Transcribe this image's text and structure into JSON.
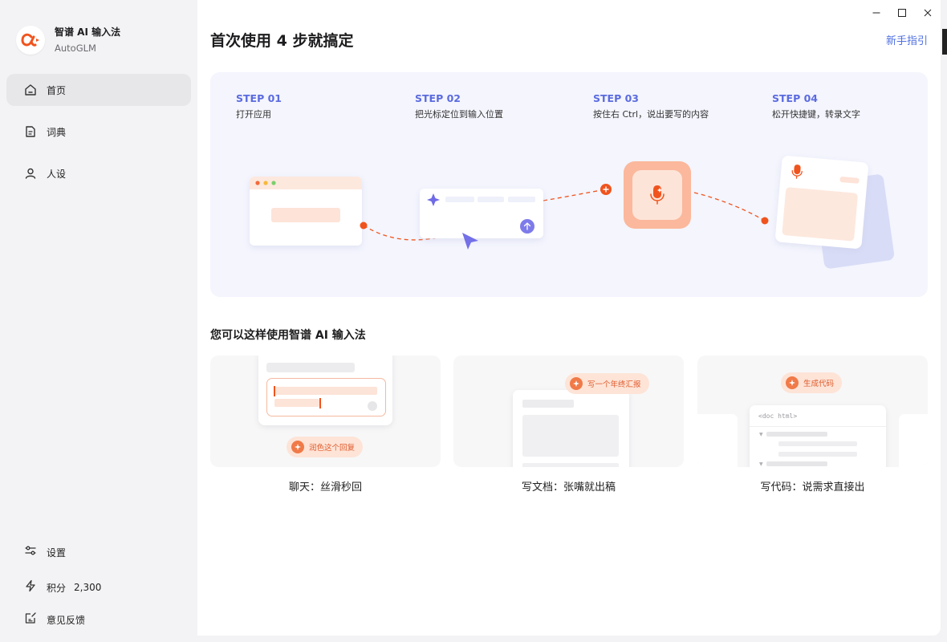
{
  "brand": {
    "name": "智谱 AI 输入法",
    "sub": "AutoGLM",
    "logo_icon": "alpha-logo-icon",
    "accent": "#f0541e"
  },
  "sidebar": {
    "items": [
      {
        "label": "首页",
        "icon": "home-icon",
        "active": true
      },
      {
        "label": "词典",
        "icon": "dictionary-icon",
        "active": false
      },
      {
        "label": "人设",
        "icon": "persona-icon",
        "active": false
      }
    ],
    "bottom": {
      "settings_label": "设置",
      "points_label": "积分",
      "points_value": "2,300",
      "feedback_label": "意见反馈"
    }
  },
  "header": {
    "title": "首次使用 4 步就搞定",
    "guide_link": "新手指引"
  },
  "steps": [
    {
      "no": "STEP 01",
      "desc": "打开应用"
    },
    {
      "no": "STEP 02",
      "desc": "把光标定位到输入位置"
    },
    {
      "no": "STEP 03",
      "desc": "按住右 Ctrl，说出要写的内容"
    },
    {
      "no": "STEP 04",
      "desc": "松开快捷键，转录文字"
    }
  ],
  "usage": {
    "title": "您可以这样使用智谱 AI 输入法",
    "cards": [
      {
        "caption": "聊天：丝滑秒回",
        "pill": "润色这个回复"
      },
      {
        "caption": "写文档：张嘴就出稿",
        "pill": "写一个年终汇报"
      },
      {
        "caption": "写代码：说需求直接出",
        "pill": "生成代码",
        "code_hint": "<doc html>"
      }
    ]
  },
  "colors": {
    "accent_orange": "#f0541e",
    "step_blue": "#5b6bdf",
    "link_blue": "#4f6fe0",
    "panel_bg": "#f4f5fd"
  }
}
